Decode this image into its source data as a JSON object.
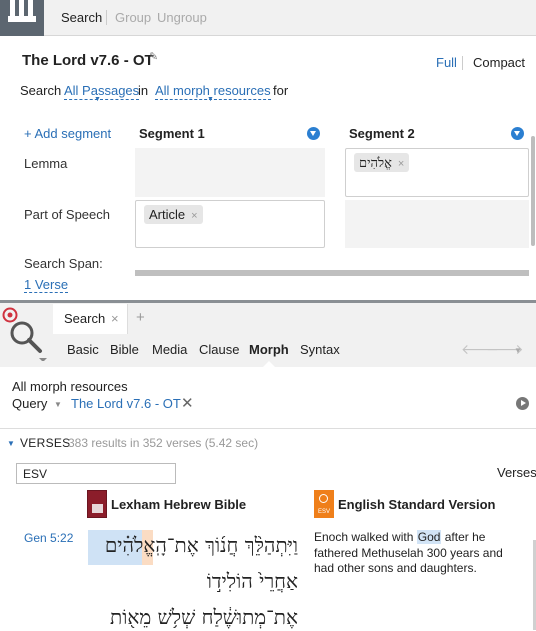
{
  "toolbar": {
    "search_label": "Search",
    "group_label": "Group",
    "ungroup_label": "Ungroup"
  },
  "query": {
    "title": "The Lord v7.6 - OT",
    "view_full": "Full",
    "view_compact": "Compact",
    "search_word": "Search",
    "passages_link": "All Passages",
    "in_word": "in",
    "resources_link": "All morph resources",
    "for_word": "for"
  },
  "segments": {
    "add_label": "+ Add segment",
    "segment1_label": "Segment 1",
    "segment2_label": "Segment 2",
    "rows": {
      "lemma_label": "Lemma",
      "pos_label": "Part of Speech"
    },
    "segment1_pos_token": "Article",
    "segment2_lemma_token": "אֱלֹהִים",
    "remove_glyph": "×"
  },
  "search_span": {
    "label": "Search Span:",
    "value": "1 Verse"
  },
  "panel": {
    "tab_label": "Search",
    "tab_close": "×",
    "new_tab": "+",
    "search_types": [
      "Basic",
      "Bible",
      "Media",
      "Clause",
      "Morph",
      "Syntax"
    ],
    "active_type": "Morph",
    "back_arrow": "🡐",
    "forward_arrow": "🡒",
    "history_caret": "▼"
  },
  "results_query": {
    "resources": "All morph resources",
    "query_label": "Query",
    "query_caret": "▼",
    "query_value": "The Lord v7.6 - OT",
    "clear_glyph": "✕"
  },
  "results": {
    "toggle": "▼",
    "section_title": "VERSES",
    "summary": "383 results in 352 verses (5.42 sec)",
    "filter_value": "ESV",
    "grouping": "Verses",
    "resources": [
      {
        "name": "Lexham Hebrew Bible",
        "icon": "lexham-book-icon",
        "color": "#8b1d2a"
      },
      {
        "name": "English Standard Version",
        "icon": "esv-icon",
        "color": "#ef7f1a",
        "icon_text": "ESV"
      }
    ],
    "verse_ref": "Gen 5:22",
    "hebrew_lines": [
      "וַיִּתְהַלֵּ֨ךְ חֲנ֜וֹךְ אֶת־הָֽאֱלֹהִ֗ים",
      "אַחֲרֵי֙ הוֹלִיד֣וֹ",
      "אֶת־מְתוּשֶׁ֔לַח שְׁל֥שׁ מֵא֖וֹת"
    ],
    "esv_before": "Enoch walked with ",
    "esv_highlight": "God",
    "esv_after": " after he fathered Methuselah 300 years and had other sons and daughters."
  }
}
